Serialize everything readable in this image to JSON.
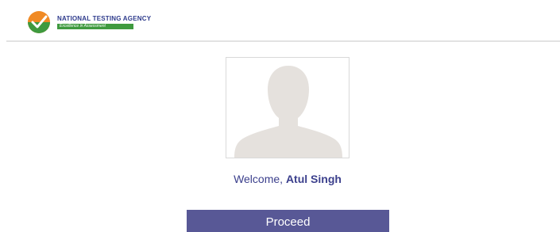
{
  "header": {
    "org_name": "NATIONAL TESTING AGENCY",
    "tagline": "Excellence in Assessment"
  },
  "profile": {
    "welcome_prefix": "Welcome,",
    "candidate_name": "Atul Singh"
  },
  "actions": {
    "proceed_label": "Proceed"
  },
  "icons": {
    "logo": "nta-logo-icon",
    "avatar": "user-silhouette-icon"
  },
  "colors": {
    "brand_blue": "#2e3b8c",
    "brand_green": "#3f9a3f",
    "logo_orange": "#f08a24",
    "button": "#585896",
    "welcome_text": "#3b3f8c"
  }
}
